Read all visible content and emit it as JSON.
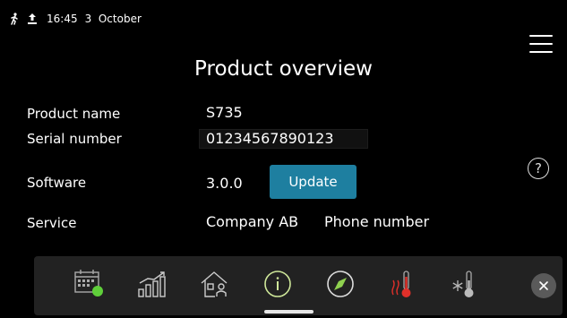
{
  "status_bar": {
    "time": "16:45",
    "date": "3  October",
    "icons": [
      "person-walking-icon",
      "upload-icon"
    ]
  },
  "page_title": "Product overview",
  "details": {
    "product_name_label": "Product name",
    "product_name_value": "S735",
    "serial_number_label": "Serial number",
    "serial_number_value": "01234567890123",
    "software_label": "Software",
    "software_value": "3.0.0",
    "update_button_label": "Update",
    "service_label": "Service",
    "service_company": "Company AB",
    "service_phone": "Phone number"
  },
  "help_label": "?",
  "nav": {
    "items": [
      {
        "name": "calendar-icon"
      },
      {
        "name": "statistics-icon"
      },
      {
        "name": "home-user-icon"
      },
      {
        "name": "info-icon"
      },
      {
        "name": "compass-icon"
      },
      {
        "name": "heating-thermometer-icon"
      },
      {
        "name": "cooling-thermometer-icon"
      }
    ],
    "close_icon": "close-icon"
  },
  "colors": {
    "background": "#000000",
    "accent": "#1e7fa0",
    "info_green": "#5fcf3a",
    "heat_red": "#e0302a"
  }
}
